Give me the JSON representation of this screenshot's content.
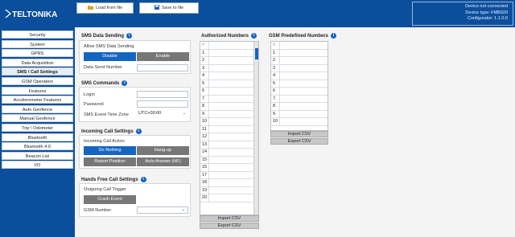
{
  "header": {
    "brand": "TELTONIKA",
    "load_label": "Load from file",
    "save_label": "Save to file",
    "device_lines": [
      "Device not connected",
      "Device type: FMB920",
      "Configurator: 1.1.0.0"
    ]
  },
  "sidebar": {
    "items": [
      {
        "label": "Security"
      },
      {
        "label": "System"
      },
      {
        "label": "GPRS"
      },
      {
        "label": "Data Acquisition"
      },
      {
        "label": "SMS \\ Call Settings",
        "active": true
      },
      {
        "label": "GSM Operators"
      },
      {
        "label": "Features"
      },
      {
        "label": "Accelerometer Features"
      },
      {
        "label": "Auto Geofence"
      },
      {
        "label": "Manual Geofence"
      },
      {
        "label": "Trip \\ Odometer"
      },
      {
        "label": "Bluetooth"
      },
      {
        "label": "Bluetooth 4.0"
      },
      {
        "label": "Beacon List"
      },
      {
        "label": "I/O"
      }
    ]
  },
  "sms_data": {
    "title": "SMS Data Sending",
    "allow_label": "Allow SMS Data Sending",
    "disable": "Disable",
    "enable": "Enable",
    "send_number_label": "Data Send Number",
    "send_number_value": ""
  },
  "sms_commands": {
    "title": "SMS Commands",
    "login_label": "Login",
    "password_label": "Password",
    "tz_label": "SMS Event Time Zone",
    "tz_value": "UTC+00:00"
  },
  "incoming_call": {
    "title": "Incoming Call Settings",
    "action_label": "Incoming Call Action",
    "do_nothing": "Do Nothing",
    "hang_up": "Hang-up",
    "report_position": "Report Position",
    "auto_answer": "Auto Answer (HF)"
  },
  "hands_free": {
    "title": "Hands Free Call Settings",
    "trigger_label": "Outgoing Call Trigger",
    "crash_event": "Crash Event",
    "gsm_number_label": "GSM Number"
  },
  "authorized": {
    "title": "Authorized Numbers",
    "header_mark": "#",
    "rows": [
      "1",
      "2",
      "3",
      "4",
      "5",
      "6",
      "7",
      "8",
      "9",
      "10",
      "11",
      "12",
      "13",
      "14",
      "15",
      "16",
      "17",
      "18",
      "19",
      "20"
    ],
    "import": "Import CSV",
    "export": "Export CSV"
  },
  "predefined": {
    "title": "GSM Predefined Numbers",
    "header_mark": "#",
    "rows": [
      "1",
      "2",
      "3",
      "4",
      "5",
      "6",
      "7",
      "8",
      "9",
      "10"
    ],
    "import": "Import CSV",
    "export": "Export CSV"
  },
  "colors": {
    "brand_blue": "#0b4f9c",
    "accent": "#1565c0",
    "toggle_off": "#777777"
  },
  "icons": {
    "load": "folder-open-icon",
    "save": "save-icon",
    "info": "info-icon",
    "dropdown": "chevron-down-icon"
  }
}
